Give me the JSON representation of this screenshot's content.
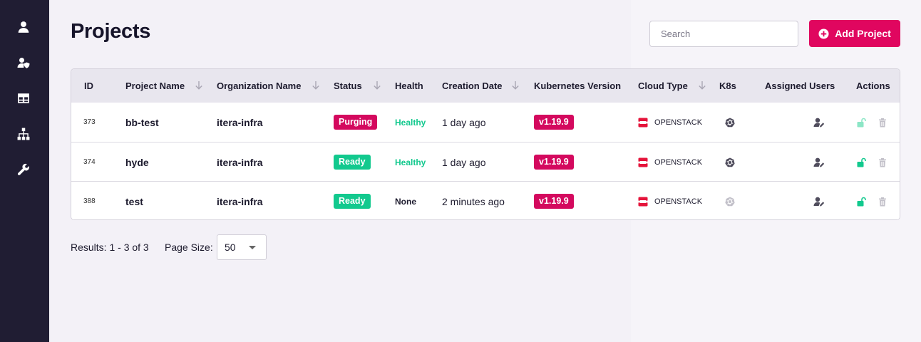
{
  "sidebar": {
    "items": [
      {
        "icon": "user-icon"
      },
      {
        "icon": "user-shield-icon"
      },
      {
        "icon": "table-icon"
      },
      {
        "icon": "sitemap-icon"
      },
      {
        "icon": "wrench-icon"
      }
    ]
  },
  "header": {
    "title": "Projects",
    "search_placeholder": "Search",
    "add_label": "Add Project"
  },
  "table": {
    "columns": [
      "ID",
      "Project Name",
      "Organization Name",
      "Status",
      "Health",
      "Creation Date",
      "Kubernetes Version",
      "Cloud Type",
      "K8s",
      "Assigned Users",
      "Actions"
    ],
    "rows": [
      {
        "id": "373",
        "name": "bb-test",
        "org": "itera-infra",
        "status": "Purging",
        "health": "Healthy",
        "created": "1 day ago",
        "version": "v1.19.9",
        "cloud": "OPENSTACK",
        "k8s_active": true,
        "unlock_faded": true
      },
      {
        "id": "374",
        "name": "hyde",
        "org": "itera-infra",
        "status": "Ready",
        "health": "Healthy",
        "created": "1 day ago",
        "version": "v1.19.9",
        "cloud": "OPENSTACK",
        "k8s_active": true,
        "unlock_faded": false
      },
      {
        "id": "388",
        "name": "test",
        "org": "itera-infra",
        "status": "Ready",
        "health": "None",
        "created": "2 minutes ago",
        "version": "v1.19.9",
        "cloud": "OPENSTACK",
        "k8s_active": false,
        "unlock_faded": false
      }
    ]
  },
  "footer": {
    "results": "Results: 1 - 3 of 3",
    "page_size_label": "Page Size:",
    "page_size": "50"
  },
  "colors": {
    "accent": "#e0065f",
    "success": "#12c98e",
    "sidebar": "#201d33"
  }
}
